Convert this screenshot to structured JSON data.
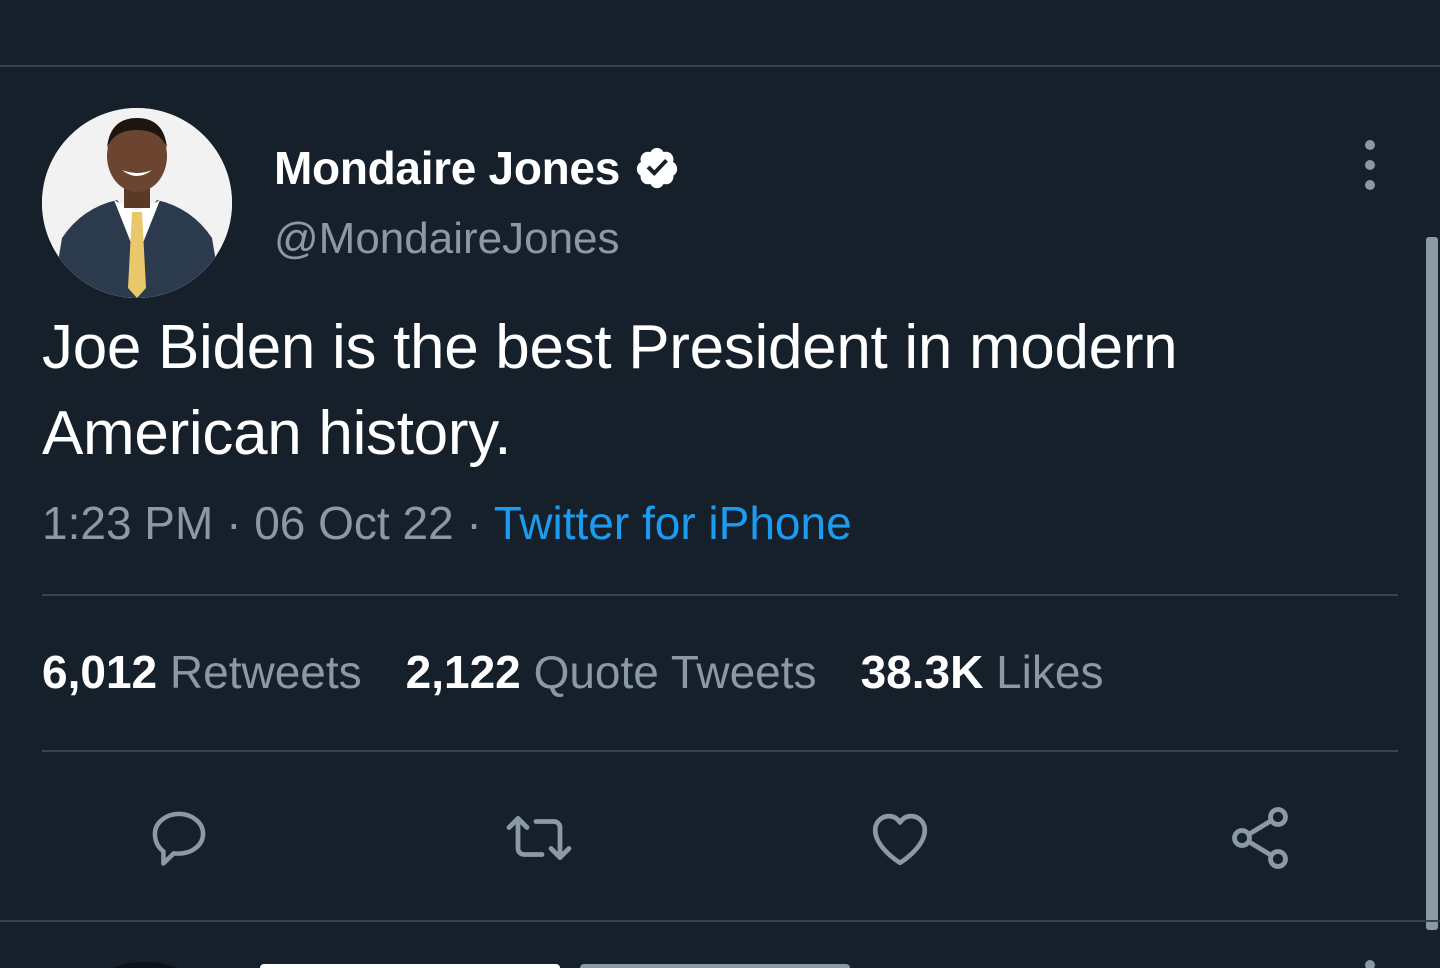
{
  "tweet": {
    "author": {
      "display_name": "Mondaire Jones",
      "handle": "@MondaireJones",
      "verified": true,
      "avatar_icon": "profile-photo"
    },
    "text_lines": [
      "Joe Biden is the best President in modern",
      "American history."
    ],
    "meta": {
      "time": "1:23 PM",
      "separator": " · ",
      "date": "06 Oct 22",
      "source": "Twitter for iPhone"
    },
    "stats": [
      {
        "value": "6,012",
        "label": "Retweets"
      },
      {
        "value": "2,122",
        "label": "Quote Tweets"
      },
      {
        "value": "38.3K",
        "label": "Likes"
      }
    ],
    "actions": [
      {
        "icon": "reply-icon"
      },
      {
        "icon": "retweet-icon"
      },
      {
        "icon": "like-icon"
      },
      {
        "icon": "share-icon"
      }
    ],
    "more_icon": "more-vertical-icon"
  },
  "colors": {
    "background": "#15202b",
    "divider": "#38444d",
    "primary_text": "#ffffff",
    "secondary_text": "#8b98a5",
    "link": "#1d9bf0"
  }
}
